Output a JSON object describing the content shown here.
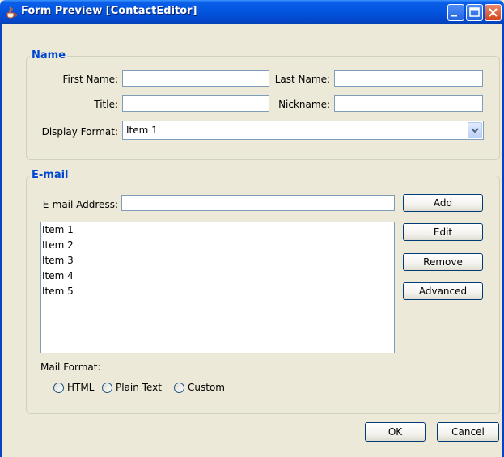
{
  "window": {
    "title": "Form Preview [ContactEditor]"
  },
  "name_group": {
    "legend": "Name",
    "first_name_label": "First Name:",
    "first_name_value": "",
    "last_name_label": "Last Name:",
    "last_name_value": "",
    "title_label": "Title:",
    "title_value": "",
    "nickname_label": "Nickname:",
    "nickname_value": "",
    "display_format_label": "Display Format:",
    "display_format_value": "Item 1"
  },
  "email_group": {
    "legend": "E-mail",
    "address_label": "E-mail Address:",
    "address_value": "",
    "buttons": {
      "add": "Add",
      "edit": "Edit",
      "remove": "Remove",
      "advanced": "Advanced"
    },
    "list_items": [
      "Item 1",
      "Item 2",
      "Item 3",
      "Item 4",
      "Item 5"
    ],
    "mail_format_label": "Mail Format:",
    "mail_format_options": [
      "HTML",
      "Plain Text",
      "Custom"
    ]
  },
  "footer": {
    "ok": "OK",
    "cancel": "Cancel"
  },
  "icons": {
    "app": "java-cup-icon",
    "minimize": "minimize-icon",
    "maximize": "maximize-icon",
    "close": "close-icon",
    "dropdown": "chevron-down-icon"
  }
}
